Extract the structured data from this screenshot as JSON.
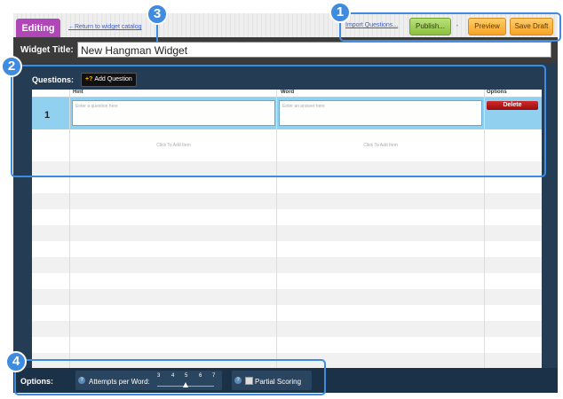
{
  "header": {
    "editing_tab": "Editing",
    "return_link": "←Return to widget catalog",
    "import_link": "Import Questions...",
    "publish_label": "Publish...",
    "separator": "•",
    "preview_label": "Preview",
    "save_draft_label": "Save Draft"
  },
  "title_bar": {
    "label": "Widget Title:",
    "value": "New Hangman Widget"
  },
  "questions": {
    "label": "Questions:",
    "add_button": "Add Question",
    "columns": [
      "",
      "Hint",
      "Word",
      "Options"
    ],
    "rows": [
      {
        "number": "1",
        "hint_placeholder": "Enter a question here",
        "word_placeholder": "Enter an answer here",
        "delete_label": "Delete"
      }
    ],
    "add_item_hint": "Click To Add Item",
    "add_item_word": "Click To Add Item"
  },
  "options": {
    "label": "Options:",
    "attempts_label": "Attempts per Word:",
    "attempt_ticks": [
      "3",
      "4",
      "5",
      "6",
      "7"
    ],
    "attempts_selected": "5",
    "partial_scoring_label": "Partial Scoring",
    "help_glyph": "?"
  },
  "callouts": [
    "1",
    "2",
    "3",
    "4"
  ],
  "colors": {
    "accent": "#3f8be0",
    "editing_tab": "#b046b8",
    "panel": "#243d55",
    "selected_row": "#92d0f0",
    "delete": "#b31818"
  }
}
